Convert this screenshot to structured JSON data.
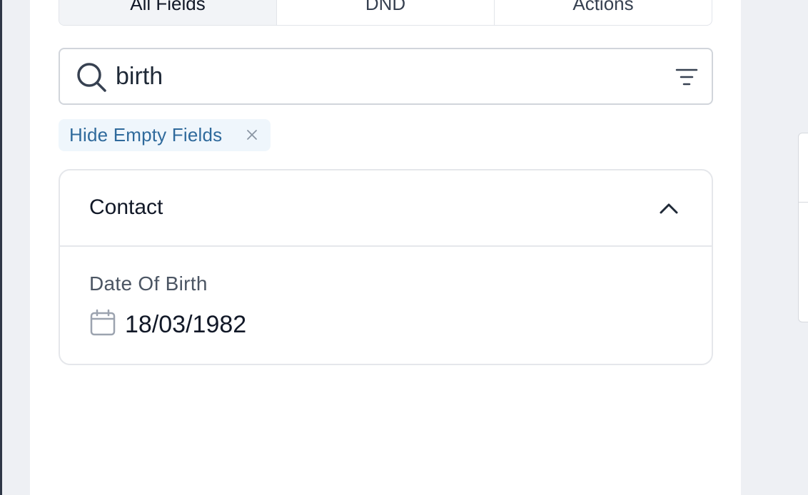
{
  "tabs": [
    {
      "label": "All Fields",
      "active": true
    },
    {
      "label": "DND",
      "active": false
    },
    {
      "label": "Actions",
      "active": false
    }
  ],
  "search": {
    "value": "birth",
    "icon": "search-icon",
    "filter_icon": "filter-icon"
  },
  "filter_chip": {
    "label": "Hide Empty Fields",
    "close_icon": "close-icon"
  },
  "section": {
    "title": "Contact",
    "expanded": true,
    "toggle_icon": "chevron-up-icon",
    "fields": [
      {
        "label": "Date Of Birth",
        "value": "18/03/1982",
        "icon": "calendar-icon"
      }
    ]
  },
  "colors": {
    "chip_bg": "#eff6fc",
    "chip_text": "#2f6a9c",
    "border": "#e5e7eb",
    "page_bg": "#eef0f4"
  }
}
